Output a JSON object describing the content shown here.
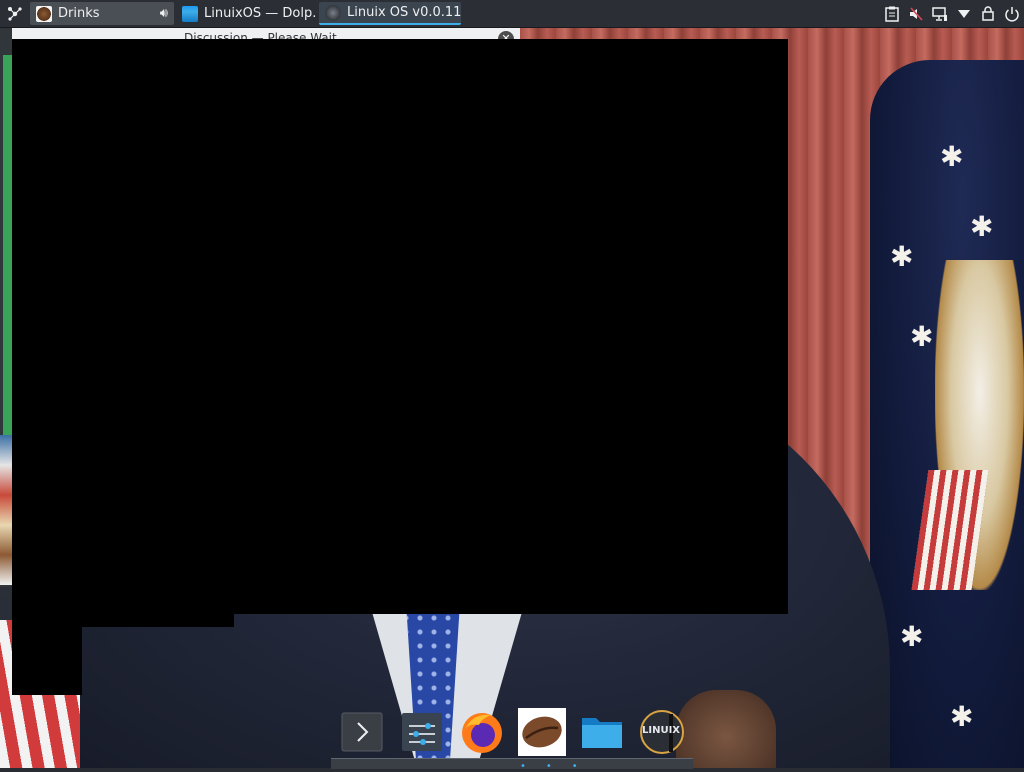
{
  "taskbar": {
    "tasks": [
      {
        "label": "Drinks"
      },
      {
        "label": "LinuixOS — Dolp..."
      },
      {
        "label": "Linuix OS v0.0.11"
      }
    ]
  },
  "background_window": {
    "title": "Discussion — Please Wait"
  },
  "dock": {
    "items": [
      {
        "name": "expand-dock"
      },
      {
        "name": "system-settings"
      },
      {
        "name": "firefox"
      },
      {
        "name": "drinks"
      },
      {
        "name": "file-manager"
      },
      {
        "name": "linuix-os"
      }
    ],
    "logo_text": "LINUIX"
  },
  "colors": {
    "panel": "#2b2f35",
    "accent": "#3daee9",
    "overlay": "#000000"
  }
}
